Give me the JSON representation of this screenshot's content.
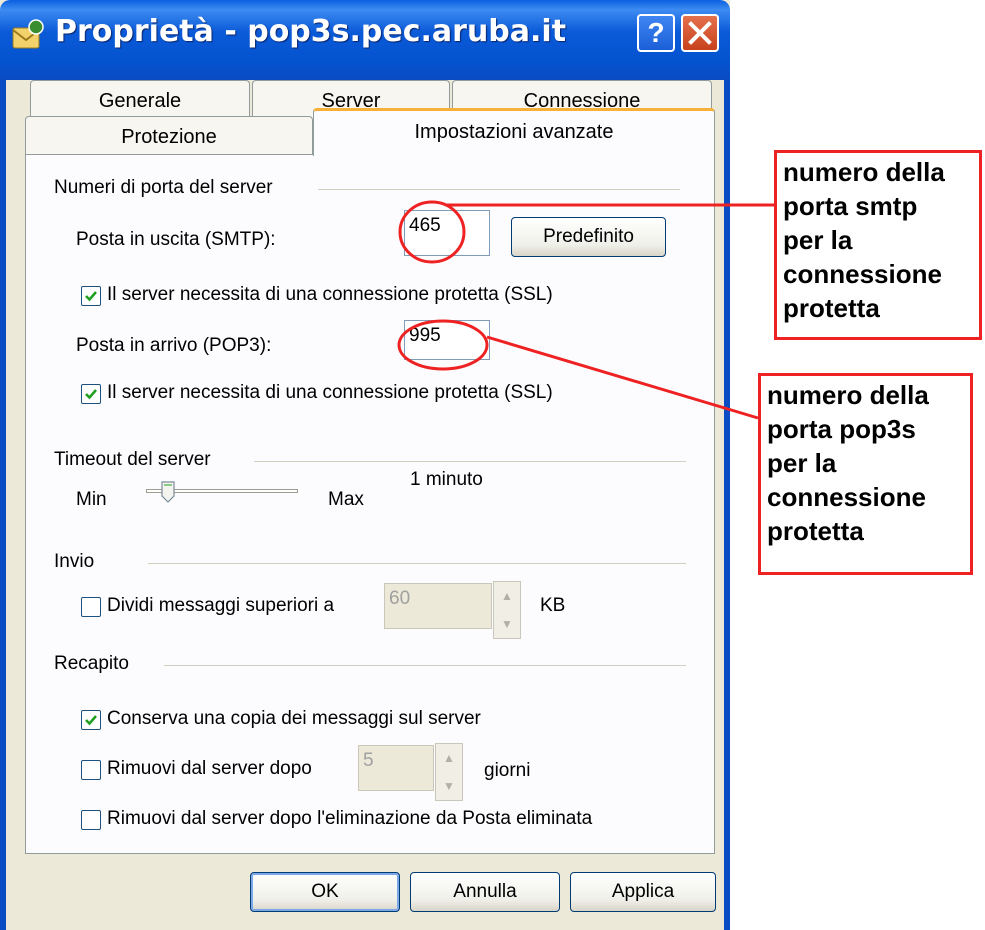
{
  "window": {
    "title": "Proprietà - pop3s.pec.aruba.it",
    "help_label": "?"
  },
  "tabs": {
    "row1": [
      "Generale",
      "Server",
      "Connessione"
    ],
    "row2": [
      "Protezione",
      "Impostazioni avanzate"
    ],
    "active": "Impostazioni avanzate"
  },
  "ports": {
    "group_label": "Numeri di porta del server",
    "smtp_label": "Posta in uscita (SMTP):",
    "smtp_value": "465",
    "default_button": "Predefinito",
    "ssl_smtp_label": "Il server necessita di una connessione protetta (SSL)",
    "ssl_smtp_checked": true,
    "pop3_label": "Posta in arrivo (POP3):",
    "pop3_value": "995",
    "ssl_pop3_label": "Il server necessita di una connessione protetta (SSL)",
    "ssl_pop3_checked": true
  },
  "timeout": {
    "group_label": "Timeout del server",
    "min_label": "Min",
    "max_label": "Max",
    "value_label": "1 minuto",
    "level": 0.1
  },
  "invio": {
    "group_label": "Invio",
    "split_label": "Dividi messaggi superiori a",
    "split_checked": false,
    "split_value": "60",
    "unit": "KB"
  },
  "recapito": {
    "group_label": "Recapito",
    "keep_copy_label": "Conserva una copia dei messaggi sul server",
    "keep_copy_checked": true,
    "remove_after_label": "Rimuovi dal server dopo",
    "remove_after_checked": false,
    "remove_after_value": "5",
    "days_unit": "giorni",
    "remove_deleted_label": "Rimuovi dal server dopo l'eliminazione da Posta eliminata",
    "remove_deleted_checked": false
  },
  "buttons": {
    "ok": "OK",
    "cancel": "Annulla",
    "apply": "Applica"
  },
  "annotations": {
    "smtp_note": [
      "numero della",
      "porta smtp",
      "per la",
      "connessione",
      "protetta"
    ],
    "pop3_note": [
      "numero della",
      "porta pop3s",
      "per la",
      "connessione",
      "protetta"
    ],
    "color": "#ee2222"
  }
}
